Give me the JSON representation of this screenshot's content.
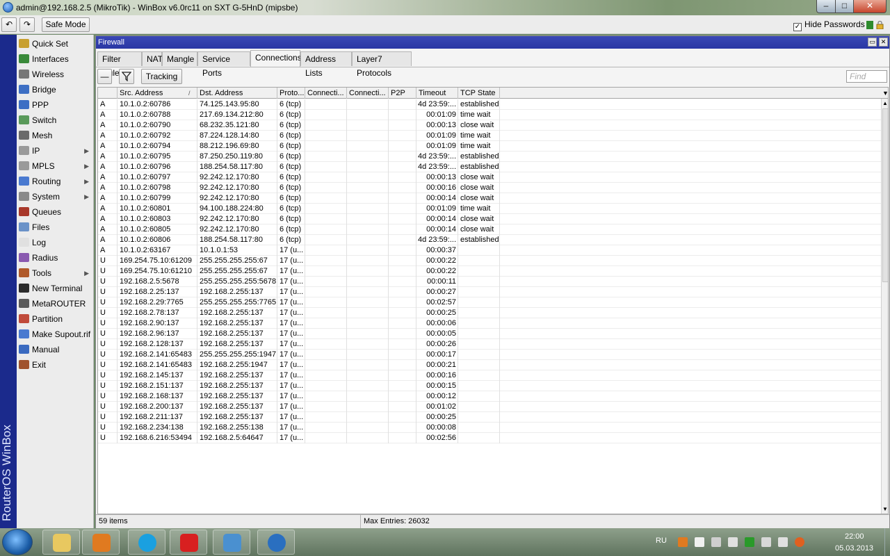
{
  "titlebar": {
    "title": "admin@192.168.2.5 (MikroTik) - WinBox v6.0rc11 on SXT G-5HnD (mipsbe)",
    "min_icon": "minimize-icon",
    "max_icon": "maximize-icon",
    "close_icon": "close-icon",
    "min_glyph": "–",
    "max_glyph": "□",
    "close_glyph": "✕"
  },
  "toolbar": {
    "undo_glyph": "↶",
    "redo_glyph": "↷",
    "safe_mode": "Safe Mode",
    "hide_passwords": "Hide Passwords",
    "hide_passwords_checked": true
  },
  "brand": "RouterOS WinBox",
  "sidebar": {
    "items": [
      {
        "label": "Quick Set",
        "icon": "quick-set-icon",
        "color": "#c8a030",
        "submenu": false
      },
      {
        "label": "Interfaces",
        "icon": "interfaces-icon",
        "color": "#3a8a3a",
        "submenu": false
      },
      {
        "label": "Wireless",
        "icon": "wireless-icon",
        "color": "#777777",
        "submenu": false
      },
      {
        "label": "Bridge",
        "icon": "bridge-icon",
        "color": "#3d6fc4",
        "submenu": false
      },
      {
        "label": "PPP",
        "icon": "ppp-icon",
        "color": "#3d6fc4",
        "submenu": false
      },
      {
        "label": "Switch",
        "icon": "switch-icon",
        "color": "#5a9a5a",
        "submenu": false
      },
      {
        "label": "Mesh",
        "icon": "mesh-icon",
        "color": "#6a6a6a",
        "submenu": false
      },
      {
        "label": "IP",
        "icon": "ip-icon",
        "color": "#9a9a9a",
        "submenu": true
      },
      {
        "label": "MPLS",
        "icon": "mpls-icon",
        "color": "#9a9a9a",
        "submenu": true
      },
      {
        "label": "Routing",
        "icon": "routing-icon",
        "color": "#4a7ad0",
        "submenu": true
      },
      {
        "label": "System",
        "icon": "system-icon",
        "color": "#8a8a8a",
        "submenu": true
      },
      {
        "label": "Queues",
        "icon": "queues-icon",
        "color": "#a8382a",
        "submenu": false
      },
      {
        "label": "Files",
        "icon": "files-icon",
        "color": "#6a92c8",
        "submenu": false
      },
      {
        "label": "Log",
        "icon": "log-icon",
        "color": "#e0e0e0",
        "submenu": false
      },
      {
        "label": "Radius",
        "icon": "radius-icon",
        "color": "#8a5ab0",
        "submenu": false
      },
      {
        "label": "Tools",
        "icon": "tools-icon",
        "color": "#b05a2a",
        "submenu": true
      },
      {
        "label": "New Terminal",
        "icon": "terminal-icon",
        "color": "#2a2a2a",
        "submenu": false
      },
      {
        "label": "MetaROUTER",
        "icon": "metarouter-icon",
        "color": "#5a5a5a",
        "submenu": false
      },
      {
        "label": "Partition",
        "icon": "partition-icon",
        "color": "#c04a3a",
        "submenu": false
      },
      {
        "label": "Make Supout.rif",
        "icon": "supout-icon",
        "color": "#4a7ad0",
        "submenu": false
      },
      {
        "label": "Manual",
        "icon": "manual-icon",
        "color": "#3a6ac0",
        "submenu": false
      },
      {
        "label": "Exit",
        "icon": "exit-icon",
        "color": "#a0522d",
        "submenu": false
      }
    ]
  },
  "firewall": {
    "title": "Firewall",
    "restore_glyph": "▭",
    "close_glyph": "✕",
    "tabs": [
      "Filter Rules",
      "NAT",
      "Mangle",
      "Service Ports",
      "Connections",
      "Address Lists",
      "Layer7 Protocols"
    ],
    "active_tab": "Connections",
    "minus_glyph": "—",
    "tracking_label": "Tracking",
    "find_placeholder": "Find",
    "columns": [
      "",
      "Src. Address",
      "Dst. Address",
      "Proto...",
      "Connecti...",
      "Connecti...",
      "P2P",
      "Timeout",
      "TCP State"
    ],
    "sorted_column_marker": "/",
    "rows": [
      [
        "A",
        "10.1.0.2:60786",
        "74.125.143.95:80",
        "6 (tcp)",
        "",
        "",
        "",
        "4d 23:59:...",
        "established"
      ],
      [
        "A",
        "10.1.0.2:60788",
        "217.69.134.212:80",
        "6 (tcp)",
        "",
        "",
        "",
        "00:01:09",
        "time wait"
      ],
      [
        "A",
        "10.1.0.2:60790",
        "68.232.35.121:80",
        "6 (tcp)",
        "",
        "",
        "",
        "00:00:13",
        "close wait"
      ],
      [
        "A",
        "10.1.0.2:60792",
        "87.224.128.14:80",
        "6 (tcp)",
        "",
        "",
        "",
        "00:01:09",
        "time wait"
      ],
      [
        "A",
        "10.1.0.2:60794",
        "88.212.196.69:80",
        "6 (tcp)",
        "",
        "",
        "",
        "00:01:09",
        "time wait"
      ],
      [
        "A",
        "10.1.0.2:60795",
        "87.250.250.119:80",
        "6 (tcp)",
        "",
        "",
        "",
        "4d 23:59:...",
        "established"
      ],
      [
        "A",
        "10.1.0.2:60796",
        "188.254.58.117:80",
        "6 (tcp)",
        "",
        "",
        "",
        "4d 23:59:...",
        "established"
      ],
      [
        "A",
        "10.1.0.2:60797",
        "92.242.12.170:80",
        "6 (tcp)",
        "",
        "",
        "",
        "00:00:13",
        "close wait"
      ],
      [
        "A",
        "10.1.0.2:60798",
        "92.242.12.170:80",
        "6 (tcp)",
        "",
        "",
        "",
        "00:00:16",
        "close wait"
      ],
      [
        "A",
        "10.1.0.2:60799",
        "92.242.12.170:80",
        "6 (tcp)",
        "",
        "",
        "",
        "00:00:14",
        "close wait"
      ],
      [
        "A",
        "10.1.0.2:60801",
        "94.100.188.224:80",
        "6 (tcp)",
        "",
        "",
        "",
        "00:01:09",
        "time wait"
      ],
      [
        "A",
        "10.1.0.2:60803",
        "92.242.12.170:80",
        "6 (tcp)",
        "",
        "",
        "",
        "00:00:14",
        "close wait"
      ],
      [
        "A",
        "10.1.0.2:60805",
        "92.242.12.170:80",
        "6 (tcp)",
        "",
        "",
        "",
        "00:00:14",
        "close wait"
      ],
      [
        "A",
        "10.1.0.2:60806",
        "188.254.58.117:80",
        "6 (tcp)",
        "",
        "",
        "",
        "4d 23:59:...",
        "established"
      ],
      [
        "A",
        "10.1.0.2:63167",
        "10.1.0.1:53",
        "17 (u...",
        "",
        "",
        "",
        "00:00:37",
        ""
      ],
      [
        "U",
        "169.254.75.10:61209",
        "255.255.255.255:67",
        "17 (u...",
        "",
        "",
        "",
        "00:00:22",
        ""
      ],
      [
        "U",
        "169.254.75.10:61210",
        "255.255.255.255:67",
        "17 (u...",
        "",
        "",
        "",
        "00:00:22",
        ""
      ],
      [
        "U",
        "192.168.2.5:5678",
        "255.255.255.255:5678",
        "17 (u...",
        "",
        "",
        "",
        "00:00:11",
        ""
      ],
      [
        "U",
        "192.168.2.25:137",
        "192.168.2.255:137",
        "17 (u...",
        "",
        "",
        "",
        "00:00:27",
        ""
      ],
      [
        "U",
        "192.168.2.29:7765",
        "255.255.255.255:7765",
        "17 (u...",
        "",
        "",
        "",
        "00:02:57",
        ""
      ],
      [
        "U",
        "192.168.2.78:137",
        "192.168.2.255:137",
        "17 (u...",
        "",
        "",
        "",
        "00:00:25",
        ""
      ],
      [
        "U",
        "192.168.2.90:137",
        "192.168.2.255:137",
        "17 (u...",
        "",
        "",
        "",
        "00:00:06",
        ""
      ],
      [
        "U",
        "192.168.2.96:137",
        "192.168.2.255:137",
        "17 (u...",
        "",
        "",
        "",
        "00:00:05",
        ""
      ],
      [
        "U",
        "192.168.2.128:137",
        "192.168.2.255:137",
        "17 (u...",
        "",
        "",
        "",
        "00:00:26",
        ""
      ],
      [
        "U",
        "192.168.2.141:65483",
        "255.255.255.255:1947",
        "17 (u...",
        "",
        "",
        "",
        "00:00:17",
        ""
      ],
      [
        "U",
        "192.168.2.141:65483",
        "192.168.2.255:1947",
        "17 (u...",
        "",
        "",
        "",
        "00:00:21",
        ""
      ],
      [
        "U",
        "192.168.2.145:137",
        "192.168.2.255:137",
        "17 (u...",
        "",
        "",
        "",
        "00:00:16",
        ""
      ],
      [
        "U",
        "192.168.2.151:137",
        "192.168.2.255:137",
        "17 (u...",
        "",
        "",
        "",
        "00:00:15",
        ""
      ],
      [
        "U",
        "192.168.2.168:137",
        "192.168.2.255:137",
        "17 (u...",
        "",
        "",
        "",
        "00:00:12",
        ""
      ],
      [
        "U",
        "192.168.2.200:137",
        "192.168.2.255:137",
        "17 (u...",
        "",
        "",
        "",
        "00:01:02",
        ""
      ],
      [
        "U",
        "192.168.2.211:137",
        "192.168.2.255:137",
        "17 (u...",
        "",
        "",
        "",
        "00:00:25",
        ""
      ],
      [
        "U",
        "192.168.2.234:138",
        "192.168.2.255:138",
        "17 (u...",
        "",
        "",
        "",
        "00:00:08",
        ""
      ],
      [
        "U",
        "192.168.6.216:53494",
        "192.168.2.5:64647",
        "17 (u...",
        "",
        "",
        "",
        "00:02:56",
        ""
      ]
    ],
    "status_items": "59 items",
    "status_max": "Max Entries: 26032"
  },
  "taskbar": {
    "apps": [
      {
        "name": "explorer-app",
        "icon": "folder-icon",
        "color": "#e8c860"
      },
      {
        "name": "media-player-app",
        "icon": "media-player-icon",
        "color": "#e07a20"
      },
      {
        "name": "skype-app",
        "icon": "skype-icon",
        "color": "#1aa0e0"
      },
      {
        "name": "yandex-browser-app",
        "icon": "yandex-icon",
        "color": "#d82020"
      },
      {
        "name": "control-panel-app",
        "icon": "control-panel-icon",
        "color": "#4a90d0"
      },
      {
        "name": "winbox-app",
        "icon": "winbox-icon",
        "color": "#2a6fc0"
      }
    ],
    "lang": "RU",
    "tray_icons": [
      "tray-app-icon",
      "volume-icon",
      "keyboard-icon",
      "network-icon",
      "flag-icon",
      "printer-icon",
      "wifi-icon",
      "antivirus-icon"
    ],
    "time": "22:00",
    "date": "05.03.2013"
  }
}
